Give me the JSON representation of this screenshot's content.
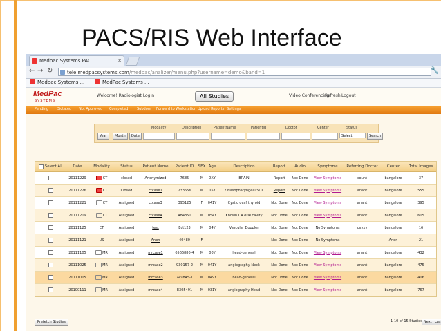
{
  "slide": {
    "title": "PACS/RIS Web Interface"
  },
  "browser": {
    "tabs": [
      {
        "label": "Medpac Systems PAC"
      },
      {
        "label": ""
      }
    ],
    "url_host": "tele.medpacsystems.com",
    "url_path": "/medpac/analizer/menu.php?username=demo&band=1",
    "bookmarks": [
      "Medpac Systems ...",
      "MedPac Systems ..."
    ]
  },
  "header": {
    "logo": "MedPac",
    "logo_sub": "SYSTEMS",
    "welcome": "Welcome! Radiologist Login",
    "all_studies": "All Studies",
    "links": [
      "Video Conferencing",
      "Refresh",
      "Logout"
    ]
  },
  "menu": [
    "Pending",
    "Dictated",
    "Not Approved",
    "Completed",
    "Subdom",
    "Forward to Workstation",
    "Upload Reports",
    "Settings"
  ],
  "search": {
    "columns": [
      "Modality",
      "Description",
      "PatientName",
      "PatientId",
      "Doctor",
      "Center",
      "Status"
    ],
    "buttons": [
      "Year",
      "Month",
      "Date"
    ],
    "status_select": "Select",
    "search_button": "Search"
  },
  "grid": {
    "headers": [
      "Select All",
      "Date",
      "Modality",
      "Status",
      "Patient Name",
      "Patient ID",
      "SEX",
      "Age",
      "Description",
      "Report",
      "Audio",
      "Symptoms",
      "Referring Doctor",
      "Center",
      "Total Images"
    ],
    "rows": [
      {
        "date": "20111229",
        "modality": "CT",
        "icon": "red",
        "status": "closed",
        "name": "Anonymized",
        "pid": "7685",
        "sex": "M",
        "age": "0XY",
        "desc": "BRAIN",
        "report": "Report",
        "audio": "Not Done",
        "symptoms": "View Symptoms",
        "ref": "count",
        "center": "bangalore",
        "images": "37"
      },
      {
        "date": "20111226",
        "modality": "CT",
        "icon": "red",
        "status": "Closed",
        "name": "ctcase1",
        "pid": "233656",
        "sex": "M",
        "age": "05Y",
        "desc": "? Nasopharyngeal SOL",
        "report": "Report",
        "audio": "Not Done",
        "symptoms": "View Symptoms",
        "ref": "anant",
        "center": "bangalore",
        "images": "555"
      },
      {
        "date": "20111221",
        "modality": "CT",
        "icon": "plain",
        "status": "Assigned",
        "name": "ctcase3",
        "pid": "395125",
        "sex": "F",
        "age": "041Y",
        "desc": "Cystic ovaf thyroid",
        "report": "Not Done",
        "audio": "Not Done",
        "symptoms": "View Symptoms",
        "ref": "anant",
        "center": "bangalore",
        "images": "395"
      },
      {
        "date": "20111219",
        "modality": "CT",
        "icon": "plain",
        "status": "Assigned",
        "name": "ctcase4",
        "pid": "484851",
        "sex": "M",
        "age": "054Y",
        "desc": "Known CA oral cavity",
        "report": "Not Done",
        "audio": "Not Done",
        "symptoms": "View Symptoms",
        "ref": "anant",
        "center": "bangalore",
        "images": "605"
      },
      {
        "date": "20111125",
        "modality": "CT",
        "icon": "none",
        "status": "Assigned",
        "name": "test",
        "pid": "Ect123",
        "sex": "M",
        "age": "04Y",
        "desc": "Vascular Doppler",
        "report": "Not Done",
        "audio": "Not Done",
        "symptoms": "No Symptoms",
        "ref": "cxvxv",
        "center": "bangalore",
        "images": "16"
      },
      {
        "date": "20111121",
        "modality": "US",
        "icon": "none",
        "status": "Assigned",
        "name": "Anon",
        "pid": "40480",
        "sex": "F",
        "age": "-",
        "desc": "-",
        "report": "Not Done",
        "audio": "Not Done",
        "symptoms": "No Symptoms",
        "ref": "-",
        "center": "Anon",
        "images": "21"
      },
      {
        "date": "20111105",
        "modality": "MR",
        "icon": "plain",
        "status": "Assigned",
        "name": "mrcase1",
        "pid": "0566880-4",
        "sex": "M",
        "age": "00Y",
        "desc": "head-general",
        "report": "Not Done",
        "audio": "Not Done",
        "symptoms": "View Symptoms",
        "ref": "anant",
        "center": "bangalore",
        "images": "432"
      },
      {
        "date": "20111025",
        "modality": "MR",
        "icon": "plain",
        "status": "Assigned",
        "name": "mrcase2",
        "pid": "930157-2",
        "sex": "M",
        "age": "041Y",
        "desc": "angiography-Neck",
        "report": "Not Done",
        "audio": "Not Done",
        "symptoms": "View Symptoms",
        "ref": "anant",
        "center": "bangalore",
        "images": "475"
      },
      {
        "date": "20111005",
        "modality": "MR",
        "icon": "plain",
        "status": "Assigned",
        "name": "mrcase3",
        "pid": "749845-1",
        "sex": "M",
        "age": "049Y",
        "desc": "head-general",
        "report": "Not Done",
        "audio": "Not Done",
        "symptoms": "View Symptoms",
        "ref": "anant",
        "center": "bangalore",
        "images": "406"
      },
      {
        "date": "20100111",
        "modality": "MR",
        "icon": "plain",
        "status": "Assigned",
        "name": "mrcase4",
        "pid": "E305491",
        "sex": "M",
        "age": "031Y",
        "desc": "angiography-Head",
        "report": "Not Done",
        "audio": "Not Done",
        "symptoms": "View Symptoms",
        "ref": "anant",
        "center": "bangalore",
        "images": "767"
      }
    ]
  },
  "footer": {
    "prefetch": "Prefetch Studies",
    "pager_text": "1-10 of 15 Studies",
    "next": "Next",
    "last": "Last"
  },
  "colors": {
    "menu_orange": "#e88a1e",
    "grid_highlight": "#fbd9a0",
    "symptoms_link": "#b21b8f",
    "logo_red": "#c01818"
  }
}
